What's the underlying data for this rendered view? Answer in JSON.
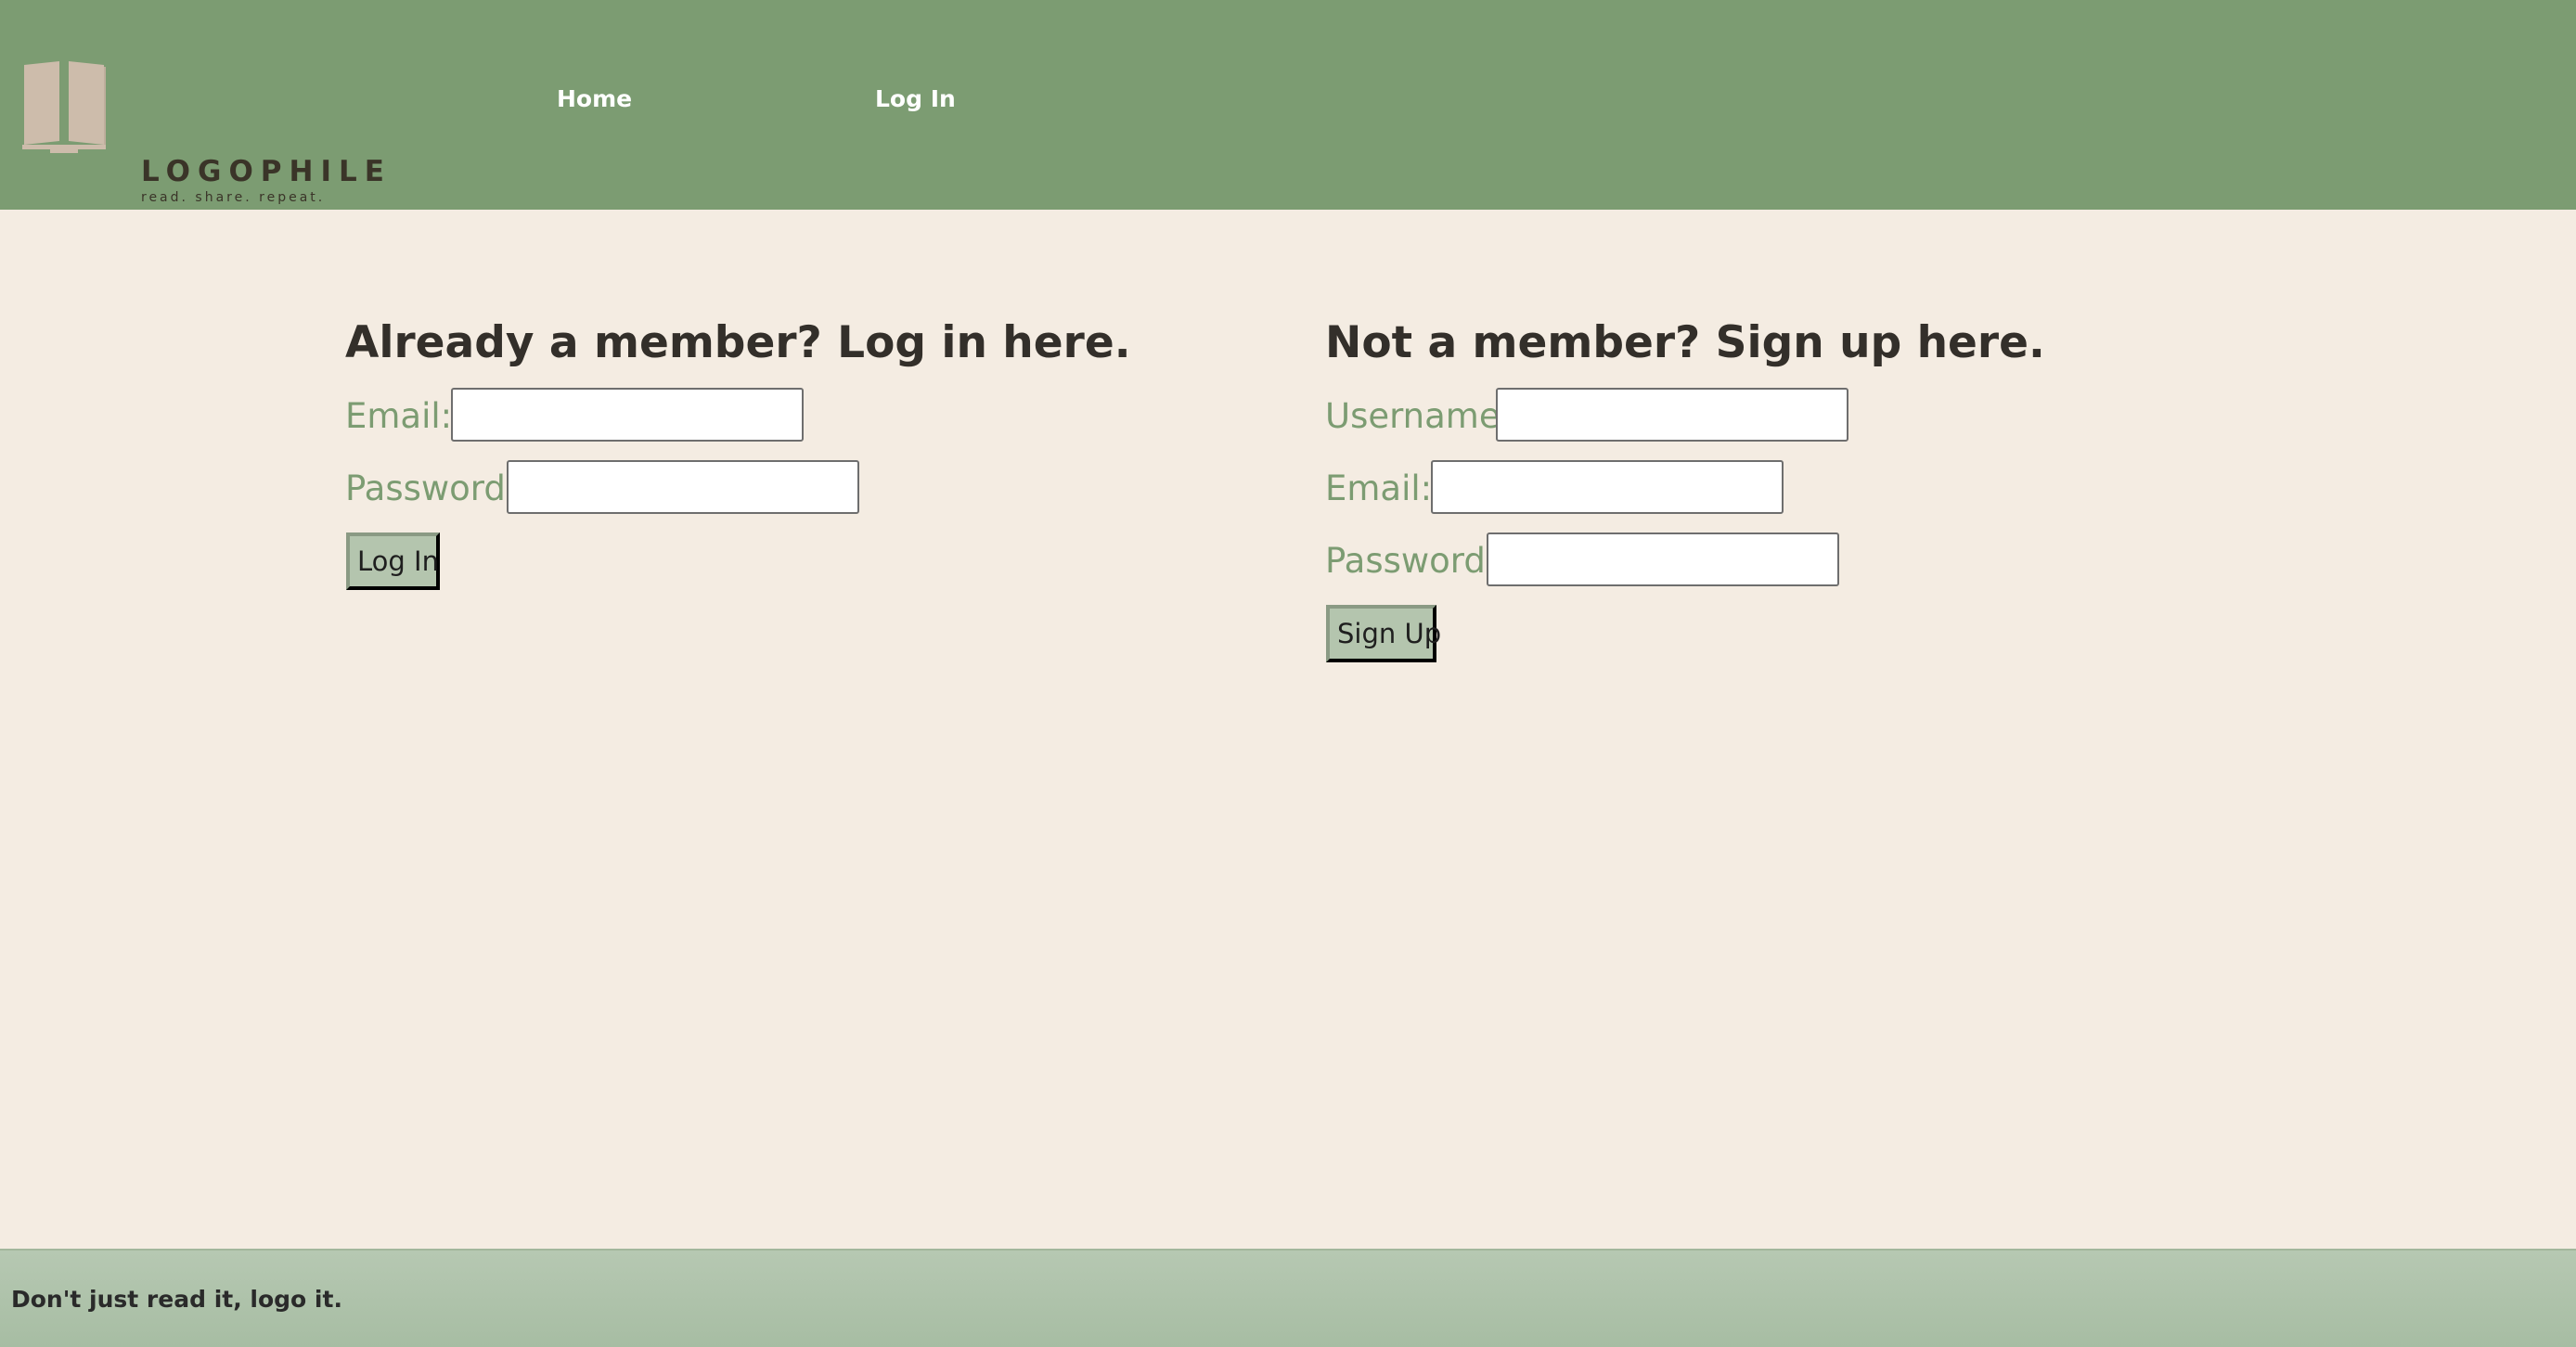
{
  "header": {
    "logo": {
      "name": "LOGOPHILE",
      "tagline": "read. share. repeat.",
      "icon": "open-book-icon"
    },
    "nav": [
      {
        "label": "Home"
      },
      {
        "label": "Log In"
      }
    ]
  },
  "login": {
    "title": "Already a member? Log in here.",
    "email_label": "Email:",
    "email_value": "",
    "password_label": "Password:",
    "password_value": "",
    "submit_label": "Log In"
  },
  "signup": {
    "title": "Not a member? Sign up here.",
    "username_label": "Username:",
    "username_value": "",
    "email_label": "Email:",
    "email_value": "",
    "password_label": "Password:",
    "password_value": "",
    "submit_label": "Sign Up"
  },
  "footer": {
    "text": "Don't just read it, logo it."
  },
  "colors": {
    "header_bg": "#7c9c72",
    "page_bg": "#f4ece2",
    "label_green": "#7c9c72",
    "button_bg": "#b4c5ae",
    "footer_bg": "#b6c8b2",
    "logo_book": "#cdbcab"
  }
}
